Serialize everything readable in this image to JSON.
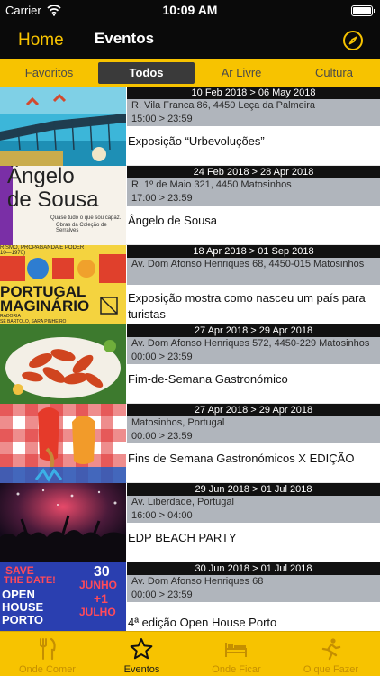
{
  "status_bar": {
    "carrier": "Carrier",
    "time": "10:09 AM"
  },
  "nav": {
    "back_label": "Home",
    "title": "Eventos",
    "right_icon": "compass-icon"
  },
  "tabs": [
    {
      "label": "Favoritos",
      "active": false
    },
    {
      "label": "Todos",
      "active": true
    },
    {
      "label": "Ar Livre",
      "active": false
    },
    {
      "label": "Cultura",
      "active": false
    }
  ],
  "events": [
    {
      "dates": "10 Feb 2018 > 06 May 2018",
      "address": "R. Vila Franca 86, 4450 Leça da Palmeira",
      "hours": "15:00 > 23:59",
      "title": "Exposição “Urbevoluções”"
    },
    {
      "dates": "24 Feb 2018 > 28 Apr 2018",
      "address": "R. 1º de Maio 321, 4450 Matosinhos",
      "hours": "17:00 > 23:59",
      "title": "Ângelo de Sousa",
      "thumb_text": {
        "line1": "Ângelo",
        "line2": "de Sousa",
        "sub1": "Quase tudo o que sou capaz.",
        "sub2": "Obras da Coleção de Serralves"
      }
    },
    {
      "dates": "18 Apr 2018 > 01 Sep 2018",
      "address": "Av. Dom Afonso Henriques 68, 4450-015 Matosinhos",
      "hours": "",
      "title": "Exposição mostra como nasceu um país para turistas",
      "thumb_text": {
        "top": "RISMO, PROPAGANDA E PODER",
        "top2": "10—1970)",
        "line1": "PORTUGAL",
        "line2": "MAGINÁRIO",
        "bottom1": "RADORIA",
        "bottom2": "SÉ BARTOLO, SARA PINHEIRO"
      }
    },
    {
      "dates": "27 Apr 2018 > 29 Apr 2018",
      "address": "Av. Dom Afonso Henriques 572, 4450-229 Matosinhos",
      "hours": "00:00 > 23:59",
      "title": "Fim-de-Semana Gastronómico"
    },
    {
      "dates": "27 Apr 2018 > 29 Apr 2018",
      "address": "Matosinhos, Portugal",
      "hours": "00:00 > 23:59",
      "title": "Fins de Semana Gastronómicos X EDIÇÃO"
    },
    {
      "dates": "29 Jun 2018 > 01 Jul 2018",
      "address": "Av. Liberdade, Portugal",
      "hours": "16:00 > 04:00",
      "title": "EDP BEACH PARTY"
    },
    {
      "dates": "30 Jun 2018 > 01 Jul 2018",
      "address": "Av. Dom Afonso Henriques 68",
      "hours": "00:00 > 23:59",
      "title": "4ª edição Open House Porto",
      "thumb_text": {
        "save1": "SAVE",
        "save2": "THE DATE!",
        "open1": "OPEN",
        "open2": "HOUSE",
        "open3": "PORTO",
        "day": "30",
        "month": "JUNHO",
        "plus": "+1",
        "month2": "JULHO"
      }
    }
  ],
  "bottom_tabs": [
    {
      "label": "Onde Comer",
      "icon": "fork-knife-icon",
      "active": false
    },
    {
      "label": "Eventos",
      "icon": "star-icon",
      "active": true
    },
    {
      "label": "Onde Ficar",
      "icon": "bed-icon",
      "active": false
    },
    {
      "label": "O que Fazer",
      "icon": "running-person-icon",
      "active": false
    }
  ],
  "colors": {
    "accent": "#f7c300",
    "bar_dark": "#0a0a0a",
    "info_gray": "#b0b5bc",
    "active_tab": "#3a3a3a"
  }
}
